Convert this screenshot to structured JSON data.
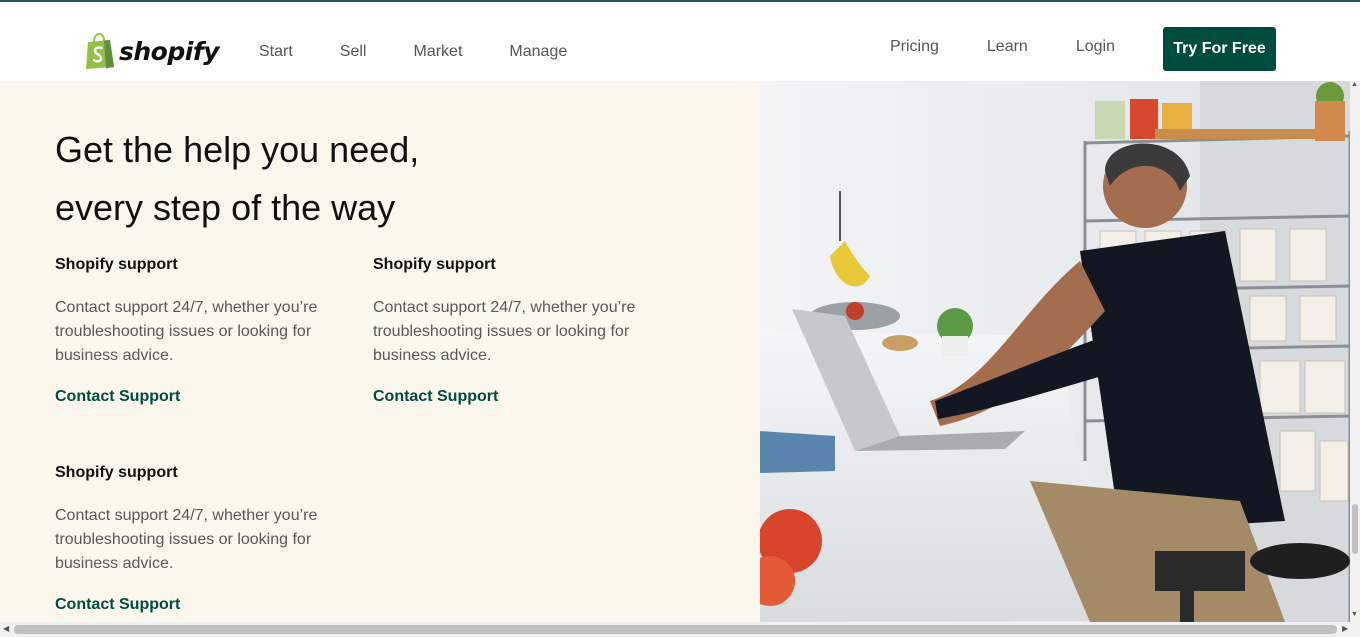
{
  "header": {
    "logo_text": "shopify",
    "nav_left": [
      "Start",
      "Sell",
      "Market",
      "Manage"
    ],
    "nav_right": [
      "Pricing",
      "Learn",
      "Login"
    ],
    "cta_label": "Try For Free"
  },
  "main": {
    "headline_line1": "Get the help you need,",
    "headline_line2": "every step of the way",
    "cards": [
      {
        "title": "Shopify support",
        "body": "Contact support 24/7, whether you’re troubleshooting issues or looking for business advice.",
        "link": "Contact Support"
      },
      {
        "title": "Shopify support",
        "body": "Contact support 24/7, whether you’re troubleshooting issues or looking for business advice.",
        "link": "Contact Support"
      },
      {
        "title": "Shopify support",
        "body": "Contact support 24/7, whether you’re troubleshooting issues or looking for business advice.",
        "link": "Contact Support"
      }
    ]
  },
  "colors": {
    "brand_green": "#004c3f",
    "panel_bg": "#fbf7ed",
    "logo_bag": "#95bf47"
  },
  "icons": {
    "logo": "shopify-bag-icon",
    "scroll_up": "arrow-up-icon",
    "scroll_down": "arrow-down-icon",
    "scroll_left": "arrow-left-icon",
    "scroll_right": "arrow-right-icon"
  }
}
